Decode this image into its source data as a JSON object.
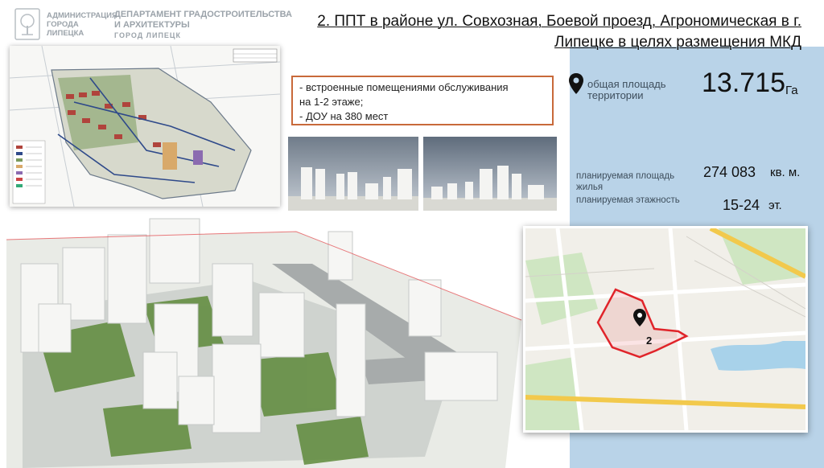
{
  "header": {
    "org_name": "АДМИНИСТРАЦИЯ ГОРОДА ЛИПЕЦКА",
    "department": "ДЕПАРТАМЕНТ ГРАДОСТРОИТЕЛЬСТВА И АРХИТЕКТУРЫ",
    "city": "ГОРОД ЛИПЕЦК",
    "logo_icon": "coat-of-arms-icon"
  },
  "title": "2. ППТ в районе ул. Совхозная, Боевой проезд, Агрономическая в г. Липецке в целях размещения МКД",
  "features": [
    "- встроенные помещениями обслуживания",
    "на 1-2 этаже;",
    "- ДОУ на 380 мест"
  ],
  "stats": {
    "area_label": "общая площадь территории",
    "area_value": "13.715",
    "area_unit": "Га",
    "housing_label": "планируемая площадь жилья",
    "housing_value": "274 083",
    "housing_unit": "кв. м.",
    "floors_label": "планируемая этажность",
    "floors_value": "15-24",
    "floors_unit": "эт."
  },
  "map": {
    "marker_label": "2",
    "marker_icon": "location-pin-icon"
  },
  "colors": {
    "panel_blue": "#b9d3e8",
    "feature_border": "#c8693a",
    "boundary_red": "#e0242a"
  }
}
